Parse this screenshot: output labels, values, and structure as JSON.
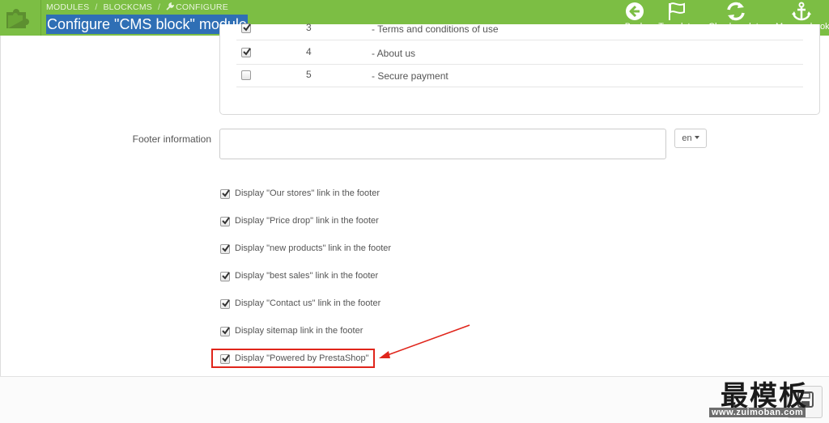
{
  "header": {
    "breadcrumb": [
      "MODULES",
      "BLOCKCMS",
      "CONFIGURE"
    ],
    "title": "Configure \"CMS block\" module",
    "actions": [
      "Back",
      "Translate",
      "Check update",
      "Manage hooks"
    ]
  },
  "cms_pages": [
    {
      "checked": true,
      "id": "3",
      "name": "- Terms and conditions of use"
    },
    {
      "checked": true,
      "id": "4",
      "name": "- About us"
    },
    {
      "checked": false,
      "id": "5",
      "name": "- Secure payment"
    }
  ],
  "footer_info": {
    "label": "Footer information",
    "value": "",
    "language": "en"
  },
  "footer_options": [
    {
      "label": "Display \"Our stores\" link in the footer",
      "checked": true
    },
    {
      "label": "Display \"Price drop\" link in the footer",
      "checked": true
    },
    {
      "label": "Display \"new products\" link in the footer",
      "checked": true
    },
    {
      "label": "Display \"best sales\" link in the footer",
      "checked": true
    },
    {
      "label": "Display \"Contact us\" link in the footer",
      "checked": true
    },
    {
      "label": "Display sitemap link in the footer",
      "checked": true
    },
    {
      "label": "Display \"Powered by PrestaShop\"",
      "checked": true
    }
  ],
  "watermark": {
    "text": "最模板",
    "url": "www.zuimoban.com"
  },
  "colors": {
    "toolbar": "#7cbe44",
    "title_highlight": "#2f6fb5",
    "annotation": "#e0251b"
  },
  "icons": {
    "logo": "puzzle-icon",
    "back": "back-arrow-icon",
    "translate": "flag-icon",
    "check_update": "refresh-icon",
    "manage_hooks": "anchor-icon",
    "save": "save-icon"
  }
}
